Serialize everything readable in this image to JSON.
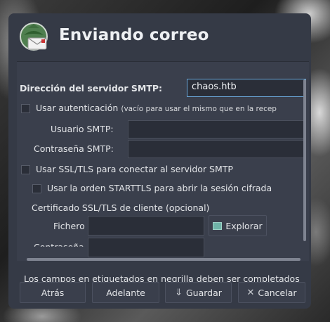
{
  "dialog": {
    "title": "Enviando correo"
  },
  "form": {
    "smtp_server_label": "Dirección del servidor SMTP:",
    "smtp_server_value": "chaos.htb",
    "use_auth_label": "Usar autenticación",
    "use_auth_hint": "(vacío para usar el mismo que en la recep",
    "smtp_user_label": "Usuario SMTP:",
    "smtp_user_value": "",
    "smtp_password_label": "Contraseña SMTP:",
    "smtp_password_value": "",
    "ssl_label": "Usar SSL/TLS para conectar al servidor SMTP",
    "starttls_label": "Usar la orden STARTTLS para abrir la sesión cifrada",
    "client_cert_label": "Certificado SSL/TLS de cliente (opcional)",
    "file_label": "Fichero",
    "file_value": "",
    "browse_label": "Explorar",
    "password_label_partial": "Contraseña",
    "password_value": ""
  },
  "footer": {
    "note": "Los campos en etiquetados en negrilla deben ser completados",
    "back_label": "Atrás",
    "next_label": "Adelante",
    "save_label": "Guardar",
    "cancel_label": "Cancelar"
  },
  "icons": {
    "title": "mail-logo-icon",
    "browse": "folder-icon",
    "save": "download-icon",
    "cancel": "close-icon"
  },
  "colors": {
    "dialog_bg": "#353a46",
    "panel_bg": "#3a3f4c",
    "focus_border": "#6aa6d8"
  }
}
